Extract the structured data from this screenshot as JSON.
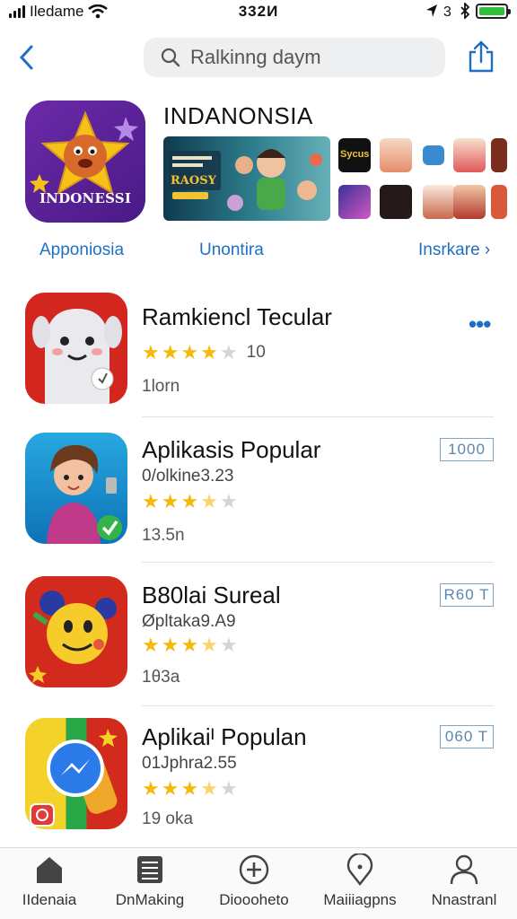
{
  "status_bar": {
    "carrier": "Iledame",
    "time": "332И"
  },
  "search": {
    "placeholder": "Ralkinng daym"
  },
  "featured": {
    "icon_label": "INDONESSI",
    "title": "INDANONSIA",
    "banner_text_1": "RAOSY",
    "thumb_text": "Sycus",
    "links": [
      "Apponiosia",
      "Unontira",
      "Insrkare"
    ]
  },
  "apps": [
    {
      "name": "Ramkiencl Tecular",
      "subtitle": "",
      "rating": 4,
      "rating_count": "10",
      "size": "1lorn",
      "action": "more"
    },
    {
      "name": "Aplikasis Popular",
      "subtitle": "0/olkine3.23",
      "rating": 3.5,
      "rating_count": "",
      "size": "13.5n",
      "action": "1000"
    },
    {
      "name": "B80lai Sureal",
      "subtitle": "Øpltaka9.A9",
      "rating": 3.5,
      "rating_count": "",
      "size": "1θ3a",
      "action": "R60 T"
    },
    {
      "name": "Aplikaiᴵ Populan",
      "subtitle": "01Jphra2.55",
      "rating": 3.5,
      "rating_count": "",
      "size": "19 oka",
      "action": "060 T"
    }
  ],
  "tabbar": {
    "items": [
      "IIdenaia",
      "DnMaking",
      "Dioooheto",
      "Maiiiagpns",
      "Nnastranl"
    ]
  },
  "colors": {
    "accent": "#1f6fc5",
    "star": "#f5b90a",
    "battery": "#2fbf3b"
  }
}
